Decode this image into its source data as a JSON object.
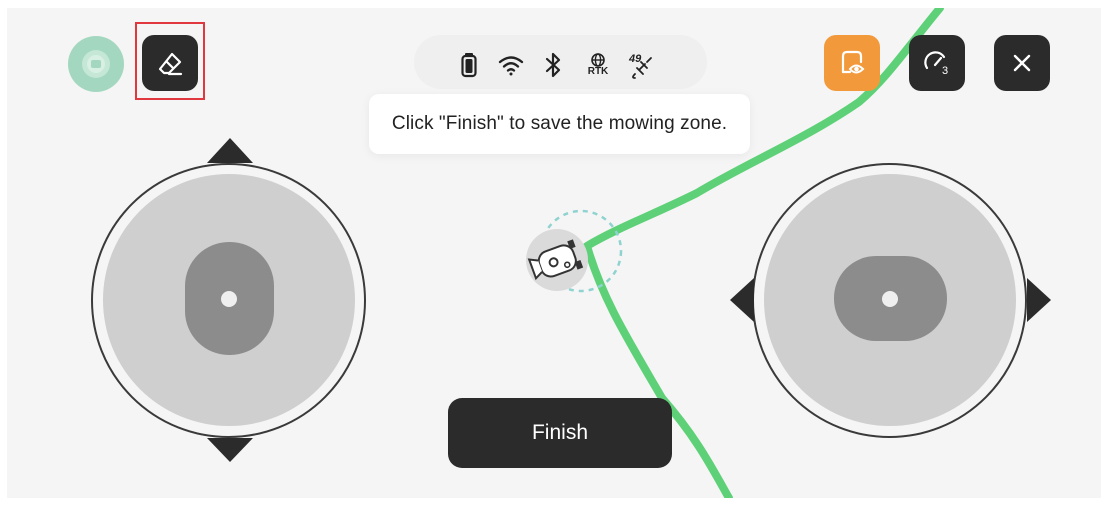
{
  "status_bar": {
    "icons": [
      "battery-icon",
      "wifi-icon",
      "bluetooth-icon",
      "rtk-icon",
      "satellite-icon"
    ],
    "rtk_label": "RTK",
    "satellite_count": "49"
  },
  "tooltip": {
    "text": "Click \"Finish\" to save the mowing zone."
  },
  "toolbar": {
    "eraser_icon": "eraser-icon",
    "mower_badge_icon": "mower-badge-icon",
    "view_icon": "eye-icon",
    "speed_icon": "speedometer-icon",
    "speed_level": "3",
    "close_icon": "close-icon"
  },
  "finish_button": {
    "label": "Finish"
  },
  "colors": {
    "path": "#5ed178",
    "accent_orange": "#f29a3b",
    "dark_button": "#2b2b2b",
    "highlight": "#e0383e",
    "badge_green": "#9fd4bc"
  }
}
